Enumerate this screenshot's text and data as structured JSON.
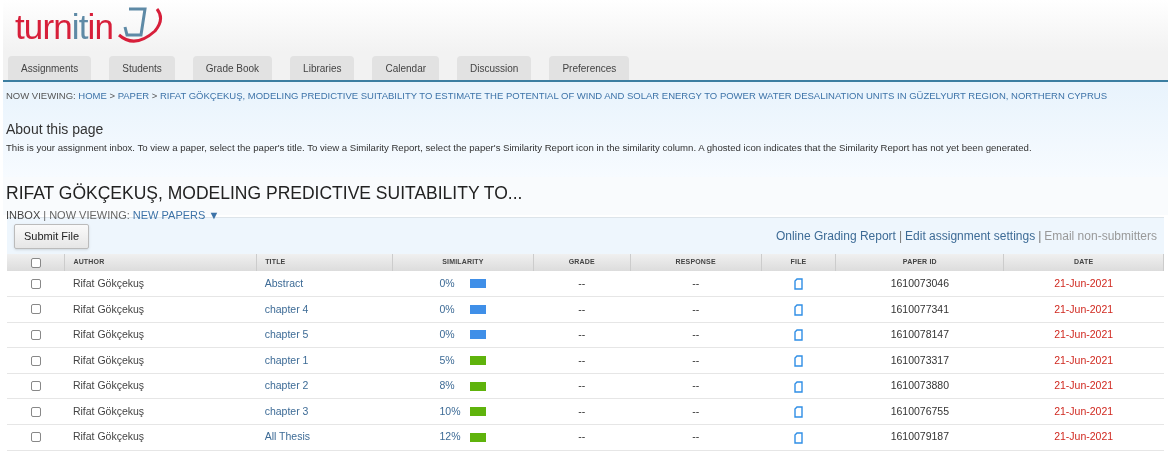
{
  "logo": {
    "parts": [
      {
        "text": "turn",
        "color": "#d71f3a"
      },
      {
        "text": "it",
        "color": "#5e8aa6"
      },
      {
        "text": "in",
        "color": "#d71f3a"
      }
    ]
  },
  "tabs": [
    {
      "label": "Assignments",
      "selected": false
    },
    {
      "label": "Students",
      "selected": false
    },
    {
      "label": "Grade Book",
      "selected": false
    },
    {
      "label": "Libraries",
      "selected": false
    },
    {
      "label": "Calendar",
      "selected": false
    },
    {
      "label": "Discussion",
      "selected": false
    },
    {
      "label": "Preferences",
      "selected": false
    }
  ],
  "breadcrumb": {
    "prefix": "NOW VIEWING:",
    "links": [
      "HOME",
      "PAPER",
      "RIFAT GÖKÇEKUŞ, MODELING PREDICTIVE SUITABILITY TO ESTIMATE THE POTENTIAL OF WIND AND SOLAR ENERGY TO POWER WATER DESALINATION UNITS IN GÜZELYURT REGION, NORTHERN CYPRUS"
    ],
    "separator": ">"
  },
  "about": {
    "heading": "About this page",
    "text": "This is your assignment inbox. To view a paper, select the paper's title. To view a Similarity Report, select the paper's Similarity Report icon in the similarity column. A ghosted icon indicates that the Similarity Report has not yet been generated."
  },
  "assignment": {
    "title": "RIFAT GÖKÇEKUŞ, MODELING PREDICTIVE SUITABILITY TO...",
    "inbox": "INBOX",
    "viewing_label": "| NOW VIEWING:",
    "viewing_value": "NEW PAPERS",
    "dropdown": "▼"
  },
  "toolbar": {
    "submit": "Submit File",
    "links": [
      {
        "label": "Online Grading Report",
        "disabled": false
      },
      {
        "label": "Edit assignment settings",
        "disabled": false
      },
      {
        "label": "Email non-submitters",
        "disabled": true
      }
    ],
    "separator": "|"
  },
  "table": {
    "select_all_checked": false,
    "columns": [
      "AUTHOR",
      "TITLE",
      "SIMILARITY",
      "GRADE",
      "RESPONSE",
      "FILE",
      "PAPER ID",
      "DATE"
    ],
    "rows": [
      {
        "checked": false,
        "author": "Rifat Gökçekuş",
        "title": "Abstract",
        "similarity": "0%",
        "color": "#3f8fe8",
        "grade": "--",
        "response": "--",
        "paper_id": "1610073046",
        "date": "21-Jun-2021"
      },
      {
        "checked": false,
        "author": "Rifat Gökçekuş",
        "title": "chapter 4",
        "similarity": "0%",
        "color": "#3f8fe8",
        "grade": "--",
        "response": "--",
        "paper_id": "1610077341",
        "date": "21-Jun-2021"
      },
      {
        "checked": false,
        "author": "Rifat Gökçekuş",
        "title": "chapter 5",
        "similarity": "0%",
        "color": "#3f8fe8",
        "grade": "--",
        "response": "--",
        "paper_id": "1610078147",
        "date": "21-Jun-2021"
      },
      {
        "checked": false,
        "author": "Rifat Gökçekuş",
        "title": "chapter 1",
        "similarity": "5%",
        "color": "#5fb30c",
        "grade": "--",
        "response": "--",
        "paper_id": "1610073317",
        "date": "21-Jun-2021"
      },
      {
        "checked": false,
        "author": "Rifat Gökçekuş",
        "title": "chapter 2",
        "similarity": "8%",
        "color": "#5fb30c",
        "grade": "--",
        "response": "--",
        "paper_id": "1610073880",
        "date": "21-Jun-2021"
      },
      {
        "checked": false,
        "author": "Rifat Gökçekuş",
        "title": "chapter 3",
        "similarity": "10%",
        "color": "#5fb30c",
        "grade": "--",
        "response": "--",
        "paper_id": "1610076755",
        "date": "21-Jun-2021"
      },
      {
        "checked": false,
        "author": "Rifat Gökçekuş",
        "title": "All Thesis",
        "similarity": "12%",
        "color": "#5fb30c",
        "grade": "--",
        "response": "--",
        "paper_id": "1610079187",
        "date": "21-Jun-2021"
      }
    ]
  }
}
